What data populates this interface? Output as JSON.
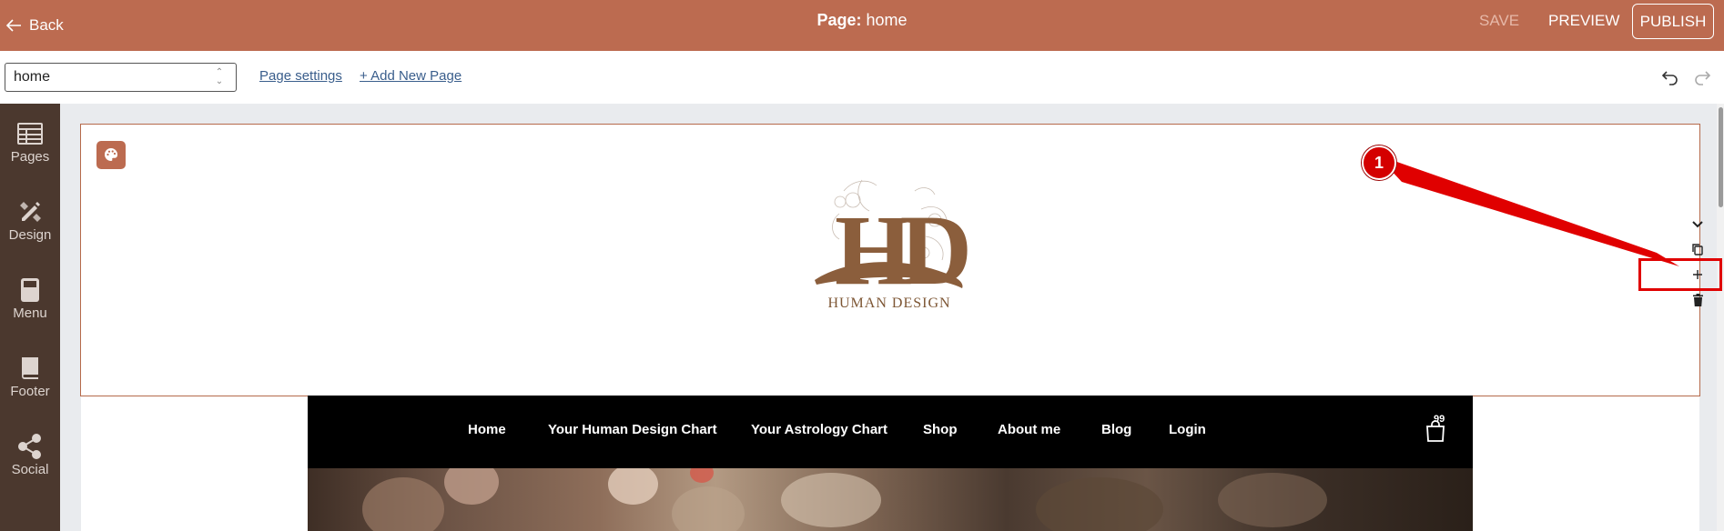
{
  "topbar": {
    "back_label": "Back",
    "title_prefix": "Page:",
    "title_value": "home",
    "save_label": "SAVE",
    "preview_label": "PREVIEW",
    "publish_label": "PUBLISH",
    "bg_color": "#bc6b50"
  },
  "subbar": {
    "page_select_value": "home",
    "page_settings_label": "Page settings",
    "add_page_label": "+ Add New Page"
  },
  "sidebar": {
    "items": [
      {
        "label": "Pages",
        "icon": "table-icon"
      },
      {
        "label": "Design",
        "icon": "pencil-ruler-icon"
      },
      {
        "label": "Menu",
        "icon": "calculator-icon"
      },
      {
        "label": "Footer",
        "icon": "book-icon"
      },
      {
        "label": "Social",
        "icon": "share-icon"
      }
    ],
    "bg_color": "#4b382e"
  },
  "header_section": {
    "logo_monogram": "HD",
    "logo_text": "HUMAN DESIGN",
    "controls": [
      "chevron-down-icon",
      "copy-icon",
      "plus-icon",
      "trash-icon"
    ]
  },
  "annotation": {
    "marker_label": "1"
  },
  "site_nav": {
    "items": [
      "Home",
      "Your Human Design Chart",
      "Your Astrology Chart",
      "Shop",
      "About me",
      "Blog",
      "Login"
    ],
    "cart_count": "99"
  }
}
